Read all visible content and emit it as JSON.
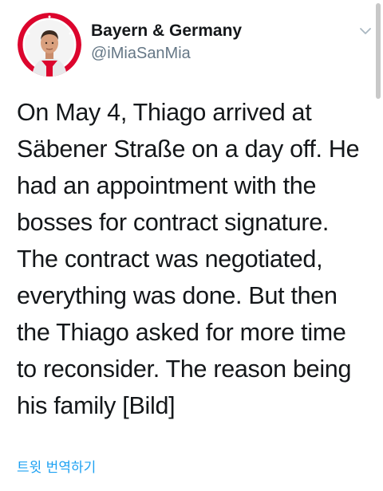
{
  "tweet": {
    "author": {
      "display_name": "Bayern & Germany",
      "handle": "@iMiaSanMia",
      "avatar_icon": "avatar-photo"
    },
    "menu_icon": "chevron-down-icon",
    "text_lines": [
      "On May 4, Thiago arrived at",
      "Säbener Straße on a day off. He",
      "had an appointment with the",
      "bosses for contract signature.",
      "The contract was negotiated,",
      "everything was done. But then",
      "the Thiago asked for more time",
      "to reconsider. The reason being",
      "his family [Bild]"
    ],
    "translate_label": "트윗 번역하기"
  },
  "colors": {
    "text": "#14171a",
    "secondary": "#657786",
    "link": "#1da1f2",
    "avatar_ring": "#dc052d"
  }
}
